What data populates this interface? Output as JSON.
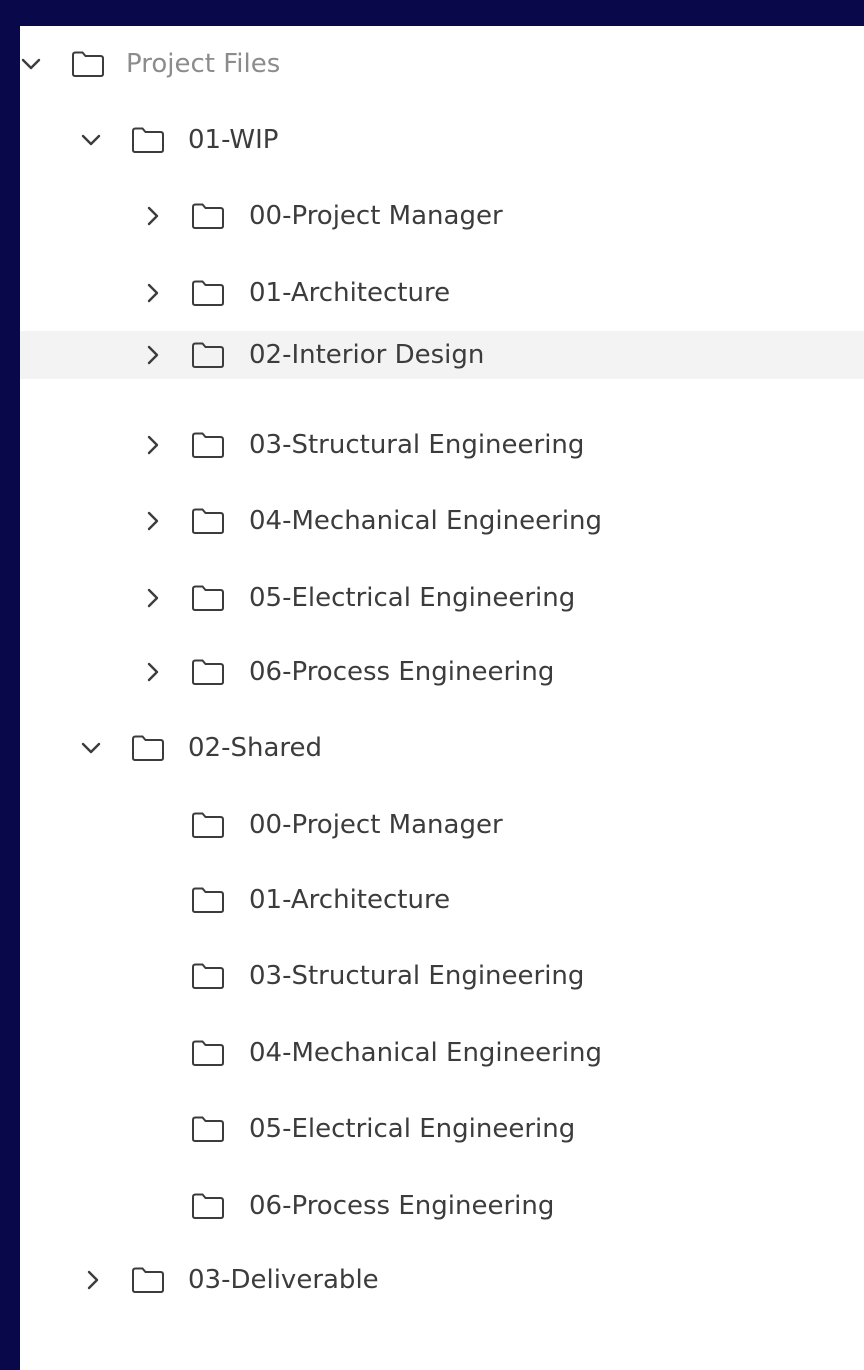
{
  "tree": {
    "root": {
      "label": "Project Files",
      "expanded": true
    },
    "wip": {
      "label": "01-WIP",
      "expanded": true,
      "children": [
        {
          "label": "00-Project Manager",
          "expanded": false
        },
        {
          "label": "01-Architecture",
          "expanded": false
        },
        {
          "label": "02-Interior Design",
          "expanded": false,
          "hovered": true
        },
        {
          "label": "03-Structural Engineering",
          "expanded": false
        },
        {
          "label": "04-Mechanical Engineering",
          "expanded": false
        },
        {
          "label": "05-Electrical Engineering",
          "expanded": false
        },
        {
          "label": "06-Process Engineering",
          "expanded": false
        }
      ]
    },
    "shared": {
      "label": "02-Shared",
      "expanded": true,
      "children": [
        {
          "label": "00-Project Manager"
        },
        {
          "label": "01-Architecture"
        },
        {
          "label": "03-Structural Engineering"
        },
        {
          "label": "04-Mechanical Engineering"
        },
        {
          "label": "05-Electrical Engineering"
        },
        {
          "label": "06-Process Engineering"
        }
      ]
    },
    "deliverable": {
      "label": "03-Deliverable",
      "expanded": false
    }
  },
  "icons": {
    "folder": "folder-icon",
    "expanded": "chevron-down-icon",
    "collapsed": "chevron-right-icon"
  },
  "colors": {
    "frame": "#08084a",
    "panel": "#ffffff",
    "text": "#3c3c3c",
    "root_text": "#8c8c8c",
    "hover_row": "#f3f3f3"
  }
}
